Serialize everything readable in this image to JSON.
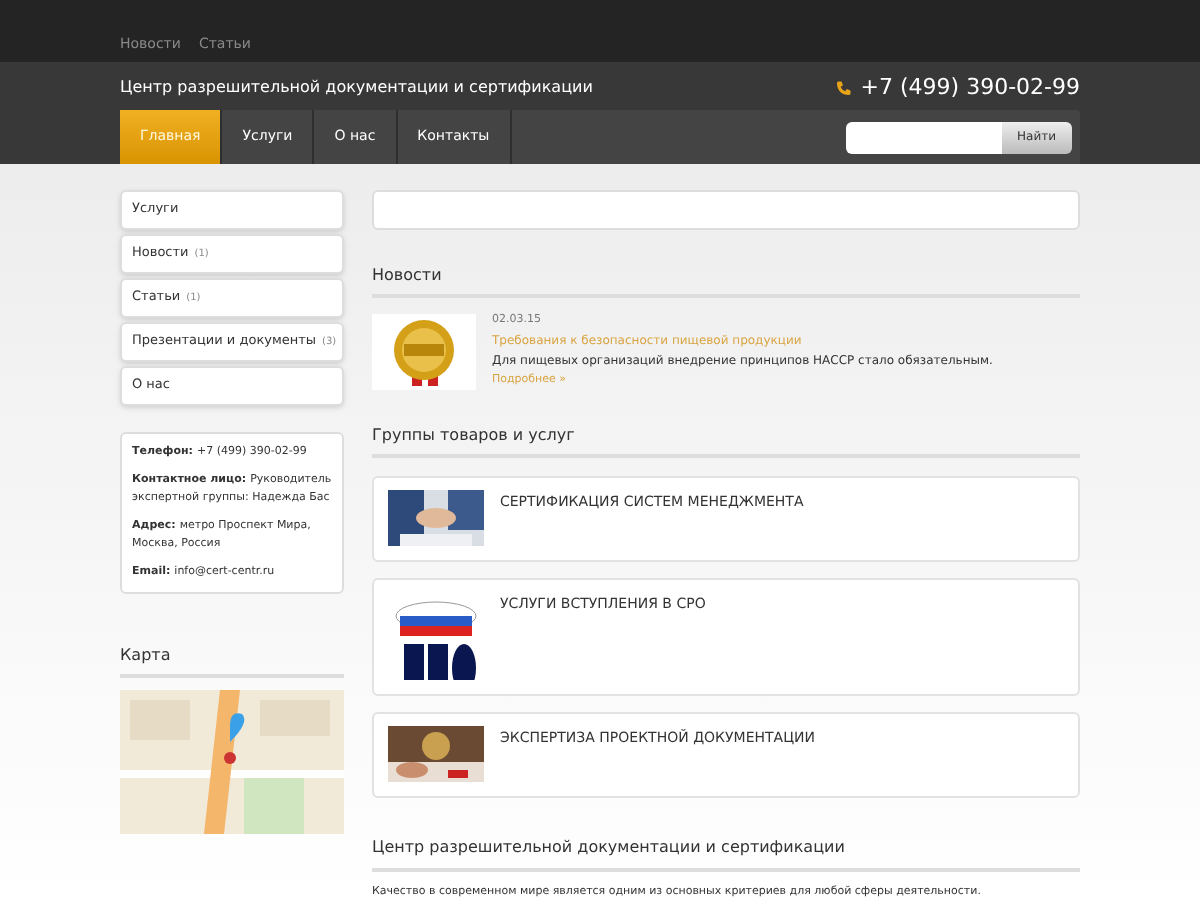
{
  "top_links": [
    "Новости",
    "Статьи"
  ],
  "site_title": "Центр разрешительной документации и сертификации",
  "phone": "+7 (499) 390-02-99",
  "nav": [
    {
      "label": "Главная",
      "selected": true
    },
    {
      "label": "Услуги",
      "selected": false
    },
    {
      "label": "О нас",
      "selected": false
    },
    {
      "label": "Контакты",
      "selected": false
    }
  ],
  "search": {
    "button": "Найти"
  },
  "sidebar": [
    {
      "label": "Услуги"
    },
    {
      "label": "Новости",
      "count": "(1)"
    },
    {
      "label": "Статьи",
      "count": "(1)"
    },
    {
      "label": "Презентации и документы",
      "count": "(3)"
    },
    {
      "label": "О нас"
    }
  ],
  "contacts": [
    {
      "label": "Телефон:",
      "value": "+7 (499) 390-02-99"
    },
    {
      "label": "Контактное лицо:",
      "value": "Руководитель экспертной группы: Надежда Бас"
    },
    {
      "label": "Адрес:",
      "value": "метро Проспект Мира, Москва, Россия"
    },
    {
      "label": "Email:",
      "value": "info@cert-centr.ru"
    }
  ],
  "map_heading": "Карта",
  "news_heading": "Новости",
  "news": [
    {
      "date": "02.03.15",
      "title": "Требования к безопасности пищевой продукции",
      "text": "Для пищевых организаций внедрение принципов НАССР стало обязательным.",
      "more": "Подробнее »"
    }
  ],
  "groups_heading": "Группы товаров и услуг",
  "groups": [
    {
      "title": "СЕРТИФИКАЦИЯ СИСТЕМ МЕНЕДЖМЕНТА",
      "kind": "handshake"
    },
    {
      "title": "УСЛУГИ ВСТУПЛЕНИЯ В СРО",
      "kind": "flag"
    },
    {
      "title": "ЭКСПЕРТИЗА ПРОЕКТНОЙ ДОКУМЕНТАЦИИ",
      "kind": "desk"
    }
  ],
  "about_heading": "Центр разрешительной документации и сертификации",
  "about_text": "Качество в современном мире является одним из основных критериев для любой сферы деятельности."
}
